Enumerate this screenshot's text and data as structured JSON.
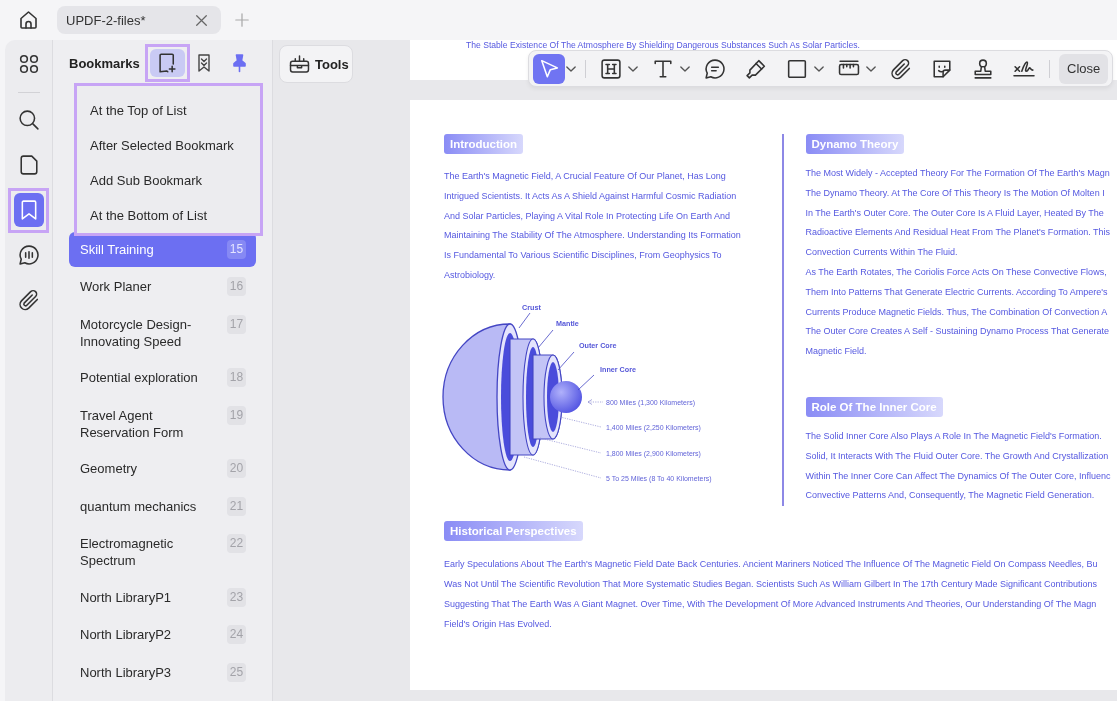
{
  "tab_bar": {
    "tabs": [
      {
        "title": "UPDF-2-files*",
        "selected": true
      }
    ]
  },
  "rail": [
    {
      "selected": false,
      "highlighted": false
    },
    {
      "selected": false,
      "highlighted": false
    },
    {
      "selected": false,
      "highlighted": false
    },
    {
      "selected": true,
      "highlighted": true
    },
    {
      "selected": false,
      "highlighted": false
    },
    {
      "selected": false,
      "highlighted": false
    }
  ],
  "bookmarks": {
    "title": "Bookmarks",
    "add_button": {
      "expanded": true,
      "highlighted": true
    },
    "pin": {
      "pinned": true
    },
    "add_menu": {
      "highlighted": true,
      "items": [
        "At the Top of List",
        "After Selected Bookmark",
        "Add Sub Bookmark",
        "At the Bottom of List"
      ]
    },
    "items": [
      {
        "title": "Skill Training",
        "page": "15",
        "selected": true
      },
      {
        "title": "Work Planer",
        "page": "16",
        "selected": false
      },
      {
        "title": "Motorcycle Design-Innovating Speed",
        "page": "17",
        "selected": false
      },
      {
        "title": "Potential exploration",
        "page": "18",
        "selected": false
      },
      {
        "title": "Travel Agent Reservation Form",
        "page": "19",
        "selected": false
      },
      {
        "title": "Geometry",
        "page": "20",
        "selected": false
      },
      {
        "title": "quantum mechanics",
        "page": "21",
        "selected": false
      },
      {
        "title": "Electromagnetic Spectrum",
        "page": "22",
        "selected": false
      },
      {
        "title": "North LibraryP1",
        "page": "23",
        "selected": false
      },
      {
        "title": "North LibraryP2",
        "page": "24",
        "selected": false
      },
      {
        "title": "North LibraryP3",
        "page": "25",
        "selected": false
      }
    ]
  },
  "tools_button": {
    "label": "Tools"
  },
  "toolbar": {
    "tools": [
      {
        "selected": true,
        "dropdown": true
      },
      {
        "selected": false,
        "dropdown": true
      },
      {
        "selected": false,
        "dropdown": true
      },
      {
        "selected": false,
        "dropdown": false
      },
      {
        "selected": false,
        "dropdown": false
      },
      {
        "selected": false,
        "dropdown": true
      },
      {
        "selected": false,
        "dropdown": true
      },
      {
        "selected": false,
        "dropdown": false
      },
      {
        "selected": false,
        "dropdown": false
      },
      {
        "selected": false,
        "dropdown": false
      },
      {
        "selected": false,
        "dropdown": false
      }
    ],
    "close_label": "Close"
  },
  "document": {
    "previous_page_line": "The Stable Existence Of The Atmosphere By Shielding Dangerous Substances Such As Solar Particles.",
    "left_column": {
      "heading": "Introduction",
      "lines": [
        "The Earth's Magnetic Field, A Crucial Feature Of Our Planet, Has Long",
        "Intrigued Scientists. It Acts As A Shield Against Harmful Cosmic Radiation",
        "And Solar Particles, Playing A Vital Role In Protecting Life On Earth And",
        "Maintaining The Stability Of The Atmosphere. Understanding Its Formation",
        "Is Fundamental To Various Scientific Disciplines, From Geophysics To",
        "Astrobiology."
      ],
      "diagram": {
        "layers": [
          "Crust",
          "Mantle",
          "Outer Core",
          "Inner Core"
        ],
        "distances": [
          "800 Miles (1,300 Kilometers)",
          "1,400 Miles (2,250 Kilometers)",
          "1,800 Miles (2,900 Kilometers)",
          "5 To 25 Miles (8 To 40 Kilometers)"
        ]
      }
    },
    "right_column": [
      {
        "heading": "Dynamo Theory",
        "lines": [
          "The Most Widely - Accepted Theory For The Formation Of The Earth's Magn",
          "The Dynamo Theory. At The Core Of This Theory Is The Motion Of Molten I",
          "In The Earth's Outer Core. The Outer Core Is A Fluid Layer, Heated By The",
          "Radioactive Elements And Residual Heat From The Planet's Formation. This",
          "Convection Currents Within The Fluid.",
          "As The Earth Rotates, The Coriolis Force Acts On These Convective Flows,",
          "Them Into Patterns That Generate Electric Currents. According To Ampere's",
          "Currents Produce Magnetic Fields. Thus, The Combination Of Convection A",
          "The Outer Core Creates A Self - Sustaining Dynamo Process That Generate",
          "Magnetic Field."
        ]
      },
      {
        "heading": "Role Of The Inner Core",
        "lines": [
          "The Solid Inner Core Also Plays A Role In The Magnetic Field's Formation.",
          "Solid, It Interacts With The Fluid Outer Core. The Growth And Crystallization",
          "Within The Inner Core Can Affect The Dynamics Of The Outer Core, Influenc",
          "Convective Patterns And, Consequently, The Magnetic Field Generation."
        ]
      }
    ],
    "bottom_section": {
      "heading": "Historical Perspectives",
      "lines": [
        "Early Speculations About The Earth's Magnetic Field Date Back Centuries. Ancient Mariners Noticed The Influence Of The Magnetic Field On Compass Needles, Bu",
        "Was Not Until The Scientific Revolution That More Systematic Studies Began. Scientists Such As William Gilbert In The 17th Century Made Significant Contributions",
        "Suggesting That The Earth Was A Giant Magnet. Over Time, With The Development Of More Advanced Instruments And Theories, Our Understanding Of The Magn",
        "Field's Origin Has Evolved."
      ]
    }
  }
}
